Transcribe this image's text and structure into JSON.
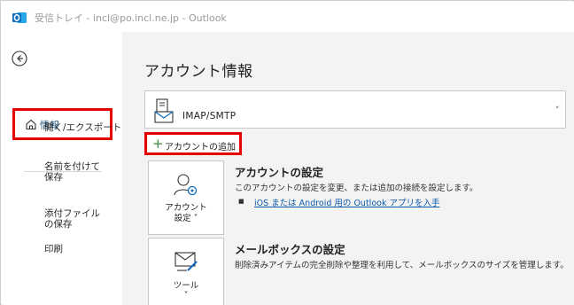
{
  "window": {
    "title": "受信トレイ - incl@po.incl.ne.jp - Outlook",
    "app_icon": "outlook-icon"
  },
  "sidebar": {
    "back_icon": "back-arrow-icon",
    "items": [
      {
        "label": "情報",
        "icon": "home-icon",
        "selected": true
      },
      {
        "label": "開く/エクスポート"
      },
      {
        "label": "名前を付けて保存"
      },
      {
        "label": "添付ファイルの保存"
      },
      {
        "label": "印刷"
      }
    ]
  },
  "main": {
    "title": "アカウント情報",
    "account_select": {
      "value": "IMAP/SMTP",
      "icon": "mailbox-icon"
    },
    "add_account": {
      "label": "アカウントの追加",
      "icon": "plus-icon"
    },
    "sections": [
      {
        "tile_label_line1": "アカウント",
        "tile_label_line2": "設定 ˅",
        "tile_icon": "account-settings-icon",
        "heading": "アカウントの設定",
        "description": "このアカウントの設定を変更、または追加の接続を設定します。",
        "link": "iOS または Android 用の Outlook アプリを入手"
      },
      {
        "tile_label_line1": "ツール",
        "tile_label_line2": "˅",
        "tile_icon": "mailbox-tools-icon",
        "heading": "メールボックスの設定",
        "description": "削除済みアイテムの完全削除や整理を利用して、メールボックスのサイズを管理します。"
      }
    ]
  },
  "colors": {
    "highlight_box": "#e60000",
    "link": "#0a58a8",
    "outlook_blue": "#0f6cbd",
    "plus_green": "#3b8a3b"
  }
}
